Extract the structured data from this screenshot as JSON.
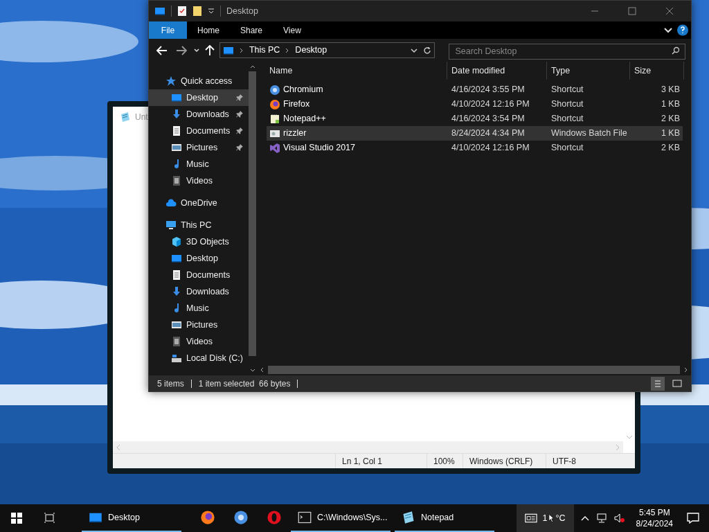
{
  "notepad": {
    "title": "Unt",
    "status": [
      "Ln 1, Col 1",
      "100%",
      "Windows (CRLF)",
      "UTF-8"
    ]
  },
  "explorer": {
    "title": "Desktop",
    "ribbon_tabs": [
      {
        "label": "File",
        "selected": true
      },
      {
        "label": "Home",
        "selected": false
      },
      {
        "label": "Share",
        "selected": false
      },
      {
        "label": "View",
        "selected": false
      }
    ],
    "breadcrumb": [
      "This PC",
      "Desktop"
    ],
    "search": {
      "placeholder": "Search Desktop"
    },
    "nav": [
      {
        "label": "Quick access",
        "kind": "star",
        "selected": false,
        "children": [
          {
            "label": "Desktop",
            "kind": "desktop",
            "pinned": true,
            "selected": true
          },
          {
            "label": "Downloads",
            "kind": "download",
            "pinned": true,
            "selected": false
          },
          {
            "label": "Documents",
            "kind": "document",
            "pinned": true,
            "selected": false
          },
          {
            "label": "Pictures",
            "kind": "pictures",
            "pinned": true,
            "selected": false
          },
          {
            "label": "Music",
            "kind": "music",
            "pinned": false,
            "selected": false
          },
          {
            "label": "Videos",
            "kind": "videos",
            "pinned": false,
            "selected": false
          }
        ]
      },
      {
        "label": "OneDrive",
        "kind": "cloud",
        "selected": false
      },
      {
        "label": "This PC",
        "kind": "pc",
        "selected": false,
        "children": [
          {
            "label": "3D Objects",
            "kind": "cube",
            "pinned": false,
            "selected": false
          },
          {
            "label": "Desktop",
            "kind": "desktop",
            "pinned": false,
            "selected": false
          },
          {
            "label": "Documents",
            "kind": "document",
            "pinned": false,
            "selected": false
          },
          {
            "label": "Downloads",
            "kind": "download",
            "pinned": false,
            "selected": false
          },
          {
            "label": "Music",
            "kind": "music",
            "pinned": false,
            "selected": false
          },
          {
            "label": "Pictures",
            "kind": "pictures",
            "pinned": false,
            "selected": false
          },
          {
            "label": "Videos",
            "kind": "videos",
            "pinned": false,
            "selected": false
          },
          {
            "label": "Local Disk (C:)",
            "kind": "disk",
            "pinned": false,
            "selected": false
          }
        ]
      }
    ],
    "columns": [
      "Name",
      "Date modified",
      "Type",
      "Size"
    ],
    "rows": [
      {
        "name": "Chromium",
        "date": "4/16/2024 3:55 PM",
        "type": "Shortcut",
        "size": "3 KB",
        "kind": "chromium",
        "selected": false
      },
      {
        "name": "Firefox",
        "date": "4/10/2024 12:16 PM",
        "type": "Shortcut",
        "size": "1 KB",
        "kind": "firefox",
        "selected": false
      },
      {
        "name": "Notepad++",
        "date": "4/16/2024 3:54 PM",
        "type": "Shortcut",
        "size": "2 KB",
        "kind": "notepadpp",
        "selected": false
      },
      {
        "name": "rizzler",
        "date": "8/24/2024 4:34 PM",
        "type": "Windows Batch File",
        "size": "1 KB",
        "kind": "batch",
        "selected": true
      },
      {
        "name": "Visual Studio 2017",
        "date": "4/10/2024 12:16 PM",
        "type": "Shortcut",
        "size": "2 KB",
        "kind": "vs",
        "selected": false
      }
    ],
    "status": [
      "5 items",
      "1 item selected  66 bytes"
    ]
  },
  "taskbar": {
    "apps": [
      {
        "label": "Desktop",
        "kind": "desktop",
        "running": true
      },
      {
        "kind": "firefox",
        "running": false
      },
      {
        "kind": "chromium",
        "running": false
      },
      {
        "kind": "opera",
        "running": false
      },
      {
        "label": "C:\\Windows\\Sys...",
        "kind": "cmd",
        "running": true
      },
      {
        "label": "Notepad",
        "kind": "notepad",
        "running": true
      }
    ],
    "weather": {
      "before": "1",
      "after": "°C"
    },
    "clock": {
      "time": "5:45 PM",
      "date": "8/24/2024"
    }
  }
}
